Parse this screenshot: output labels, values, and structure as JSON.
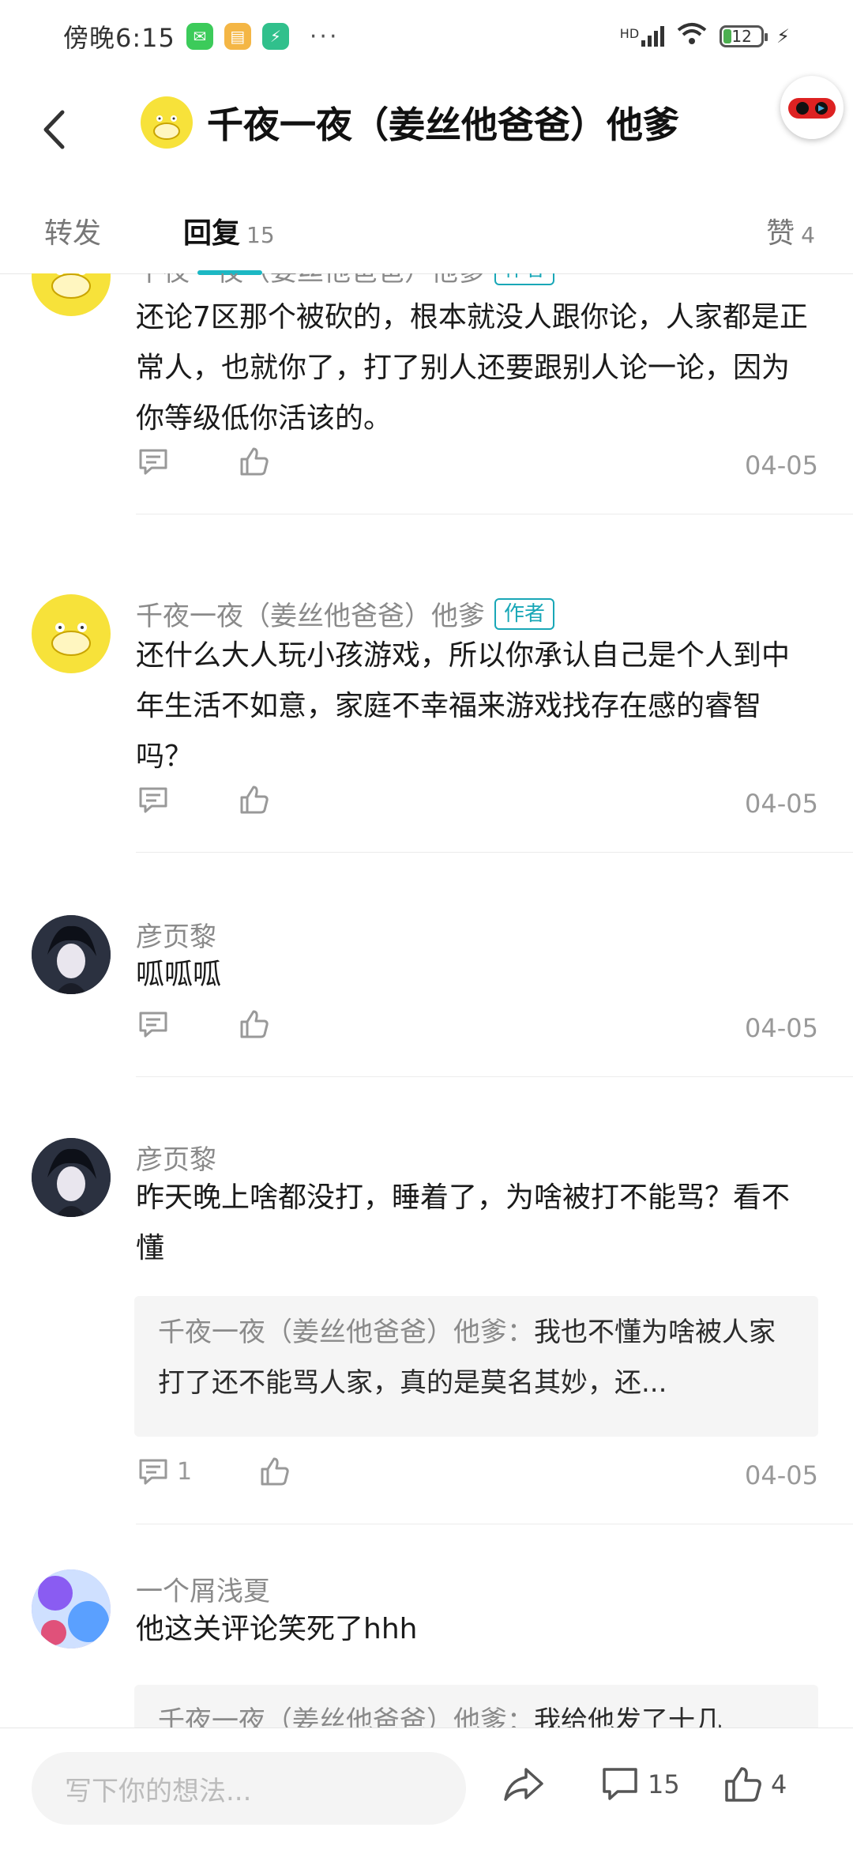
{
  "status_bar": {
    "time": "傍晚6:15",
    "more": "···",
    "network": "HD",
    "battery": "12"
  },
  "header": {
    "title": "千夜一夜（姜丝他爸爸）他爹"
  },
  "tabs": [
    {
      "label": "转发",
      "count": ""
    },
    {
      "label": "回复",
      "count": "15"
    },
    {
      "label": "赞",
      "count": "4"
    }
  ],
  "comments": [
    {
      "name": "千夜一夜（姜丝他爸爸）他爹",
      "badge": "作者",
      "text": "还论7区那个被砍的，根本就没人跟你论，人家都是正常人，也就你了，打了别人还要跟别人论一论，因为你等级低你活该的。",
      "reply_count": "",
      "date": "04-05",
      "quote_name": "",
      "quote_text": ""
    },
    {
      "name": "千夜一夜（姜丝他爸爸）他爹",
      "badge": "作者",
      "text": "还什么大人玩小孩游戏，所以你承认自己是个人到中年生活不如意，家庭不幸福来游戏找存在感的睿智吗？",
      "reply_count": "",
      "date": "04-05",
      "quote_name": "",
      "quote_text": ""
    },
    {
      "name": "彦页黎",
      "badge": "",
      "text": "呱呱呱",
      "reply_count": "",
      "date": "04-05",
      "quote_name": "",
      "quote_text": ""
    },
    {
      "name": "彦页黎",
      "badge": "",
      "text": "昨天晚上啥都没打，睡着了，为啥被打不能骂？看不懂",
      "reply_count": "1",
      "date": "04-05",
      "quote_name": "千夜一夜（姜丝他爸爸）他爹：",
      "quote_text": "我也不懂为啥被人家打了还不能骂人家，真的是莫名其妙，还..."
    },
    {
      "name": "一个屑浅夏",
      "badge": "",
      "text": "他这关评论笑死了hhh",
      "reply_count": "",
      "date": "",
      "quote_name": "千夜一夜（姜丝他爸爸）他爹：",
      "quote_text": "我给他发了十几"
    }
  ],
  "bottom_bar": {
    "input_placeholder": "写下你的想法...",
    "comment_count": "15",
    "like_count": "4"
  },
  "colors": {
    "accent": "#1cb8c4",
    "badge": "#19a7b7",
    "muted": "#999999"
  }
}
